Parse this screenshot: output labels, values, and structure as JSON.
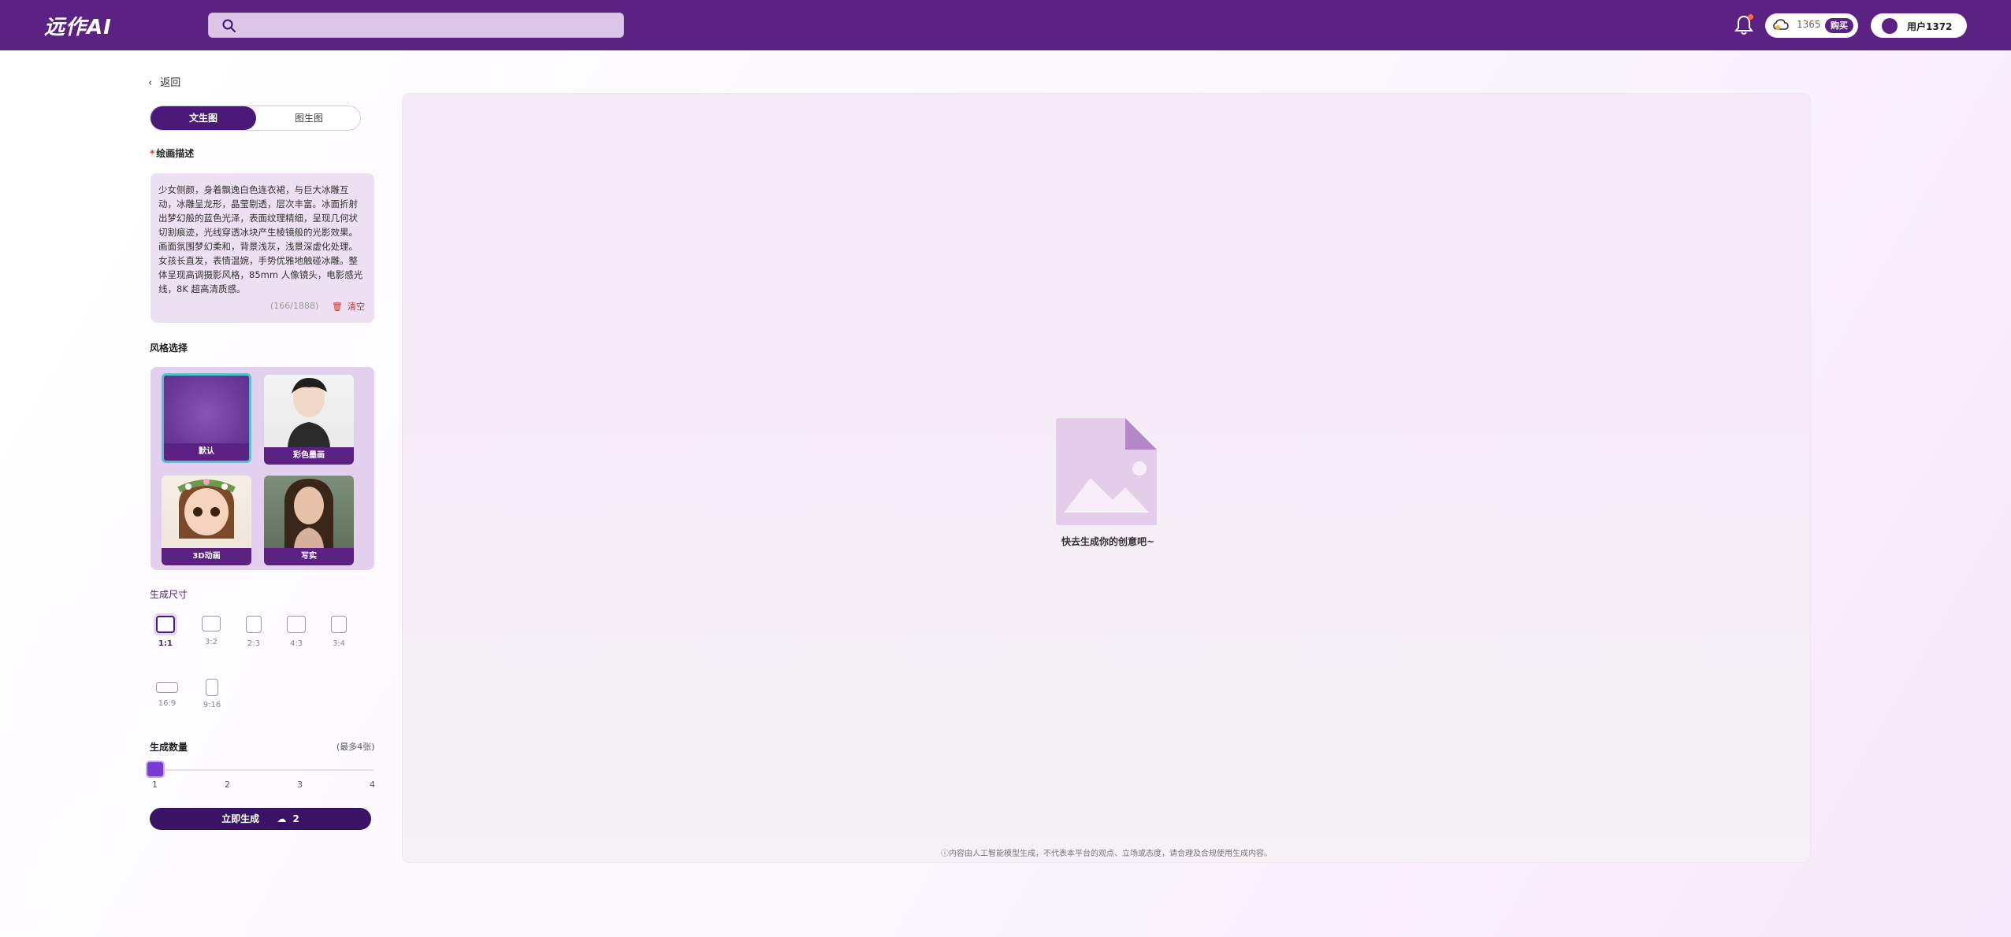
{
  "header": {
    "logo": "远作AI",
    "search_placeholder": "",
    "credits": "1365",
    "buy_label": "购买",
    "username": "用户1372"
  },
  "left": {
    "back_label": "返回",
    "tabs": [
      {
        "label": "文生图",
        "active": true
      },
      {
        "label": "图生图",
        "active": false
      }
    ],
    "prompt": {
      "label": "绘画描述",
      "text": "少女侧颜，身着飘逸白色连衣裙，与巨大冰雕互动，冰雕呈龙形，晶莹剔透，层次丰富。冰面折射出梦幻般的蓝色光泽，表面纹理精细，呈现几何状切割痕迹，光线穿透冰块产生棱镜般的光影效果。画面氛围梦幻柔和，背景浅灰，浅景深虚化处理。女孩长直发，表情温婉，手势优雅地触碰冰雕。整体呈现高调摄影风格，85mm 人像镜头，电影感光线，8K 超高清质感。",
      "counter": "(166/1888)",
      "clear_label": "清空"
    },
    "style": {
      "label": "风格选择",
      "items": [
        {
          "label": "默认",
          "selected": true
        },
        {
          "label": "彩色墨画",
          "selected": false
        },
        {
          "label": "3D动画",
          "selected": false
        },
        {
          "label": "写实",
          "selected": false
        }
      ]
    },
    "size": {
      "label": "生成尺寸",
      "options": [
        {
          "label": "1:1",
          "selected": true
        },
        {
          "label": "3:2",
          "selected": false
        },
        {
          "label": "2:3",
          "selected": false
        },
        {
          "label": "4:3",
          "selected": false
        },
        {
          "label": "3:4",
          "selected": false
        },
        {
          "label": "16:9",
          "selected": false
        },
        {
          "label": "9:16",
          "selected": false
        }
      ]
    },
    "quantity": {
      "label": "生成数量",
      "hint": "(最多4张)",
      "value": 1,
      "ticks": [
        "1",
        "2",
        "3",
        "4"
      ]
    },
    "generate": {
      "label": "立即生成",
      "cost": "2"
    }
  },
  "preview": {
    "empty_text": "快去生成你的创意吧~",
    "disclaimer": "ⓘ内容由人工智能模型生成，不代表本平台的观点、立场或态度，请合理及合规使用生成内容。"
  },
  "colors": {
    "brand": "#5b2283",
    "accent": "#7a3ad6",
    "selected_border": "#4fc3c8"
  }
}
